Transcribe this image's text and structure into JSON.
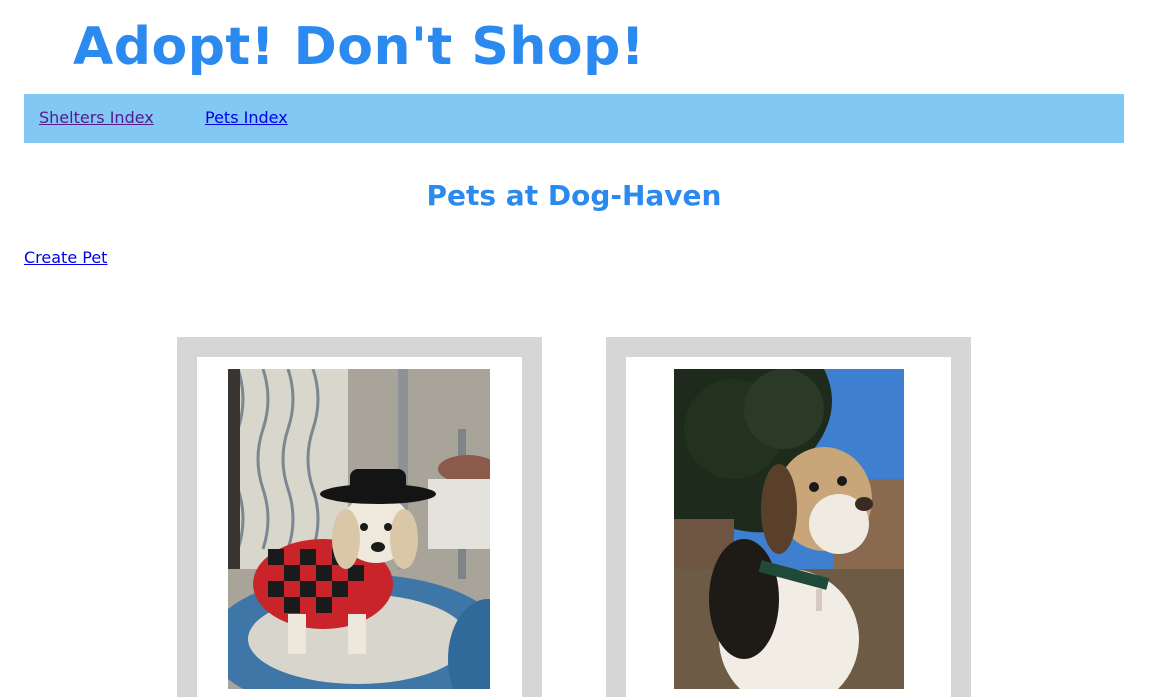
{
  "header": {
    "title": "Adopt! Don't Shop!",
    "title_color": "#2b8af0"
  },
  "nav": {
    "background": "#82c8f5",
    "items": [
      {
        "label": "Shelters Index"
      },
      {
        "label": "Pets Index"
      }
    ]
  },
  "main": {
    "heading": "Pets at Dog-Haven",
    "create_link": "Create Pet",
    "pets": [
      {
        "photo": "beagle-in-cowboy-hat-and-plaid-jacket-photo"
      },
      {
        "photo": "beagle-outdoors-photo"
      }
    ]
  }
}
